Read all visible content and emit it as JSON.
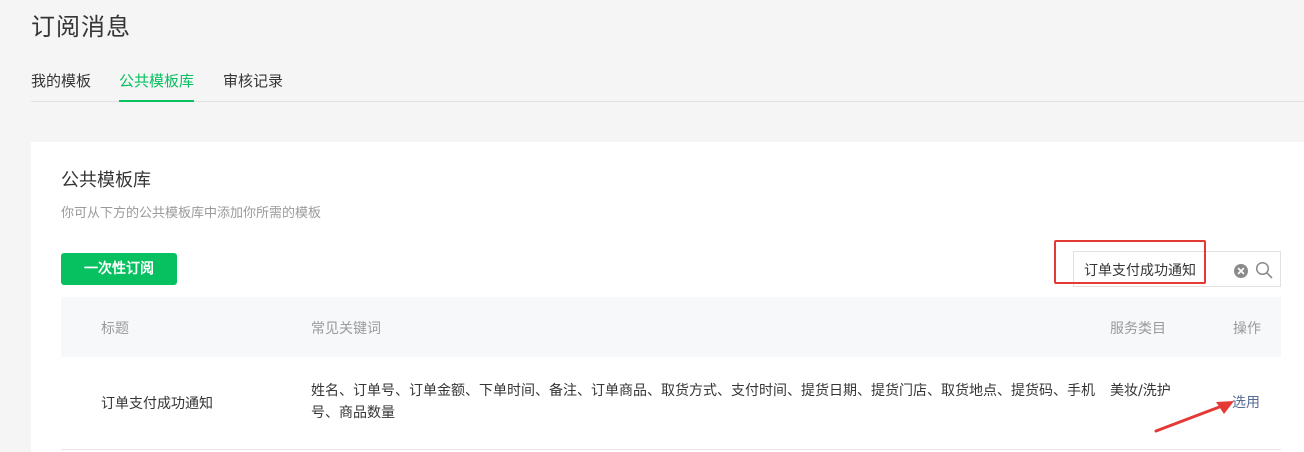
{
  "page": {
    "title": "订阅消息"
  },
  "tabs": [
    {
      "label": "我的模板",
      "active": false
    },
    {
      "label": "公共模板库",
      "active": true
    },
    {
      "label": "审核记录",
      "active": false
    }
  ],
  "card": {
    "title": "公共模板库",
    "description": "你可从下方的公共模板库中添加你所需的模板",
    "once_button_label": "一次性订阅"
  },
  "search": {
    "value": "订单支付成功通知"
  },
  "table": {
    "headers": {
      "title": "标题",
      "keywords": "常见关键词",
      "category": "服务类目",
      "action": "操作"
    },
    "rows": [
      {
        "title": "订单支付成功通知",
        "keywords": "姓名、订单号、订单金额、下单时间、备注、订单商品、取货方式、支付时间、提货日期、提货门店、取货地点、提货码、手机号、商品数量",
        "category": "美妆/洗护",
        "action": "选用"
      }
    ]
  },
  "icons": {
    "clear": "clear-circle-icon",
    "search": "search-icon",
    "annotation": "red-arrow-icon"
  },
  "colors": {
    "accent": "#07c160",
    "link": "#576b95",
    "annotation": "#e53935"
  }
}
